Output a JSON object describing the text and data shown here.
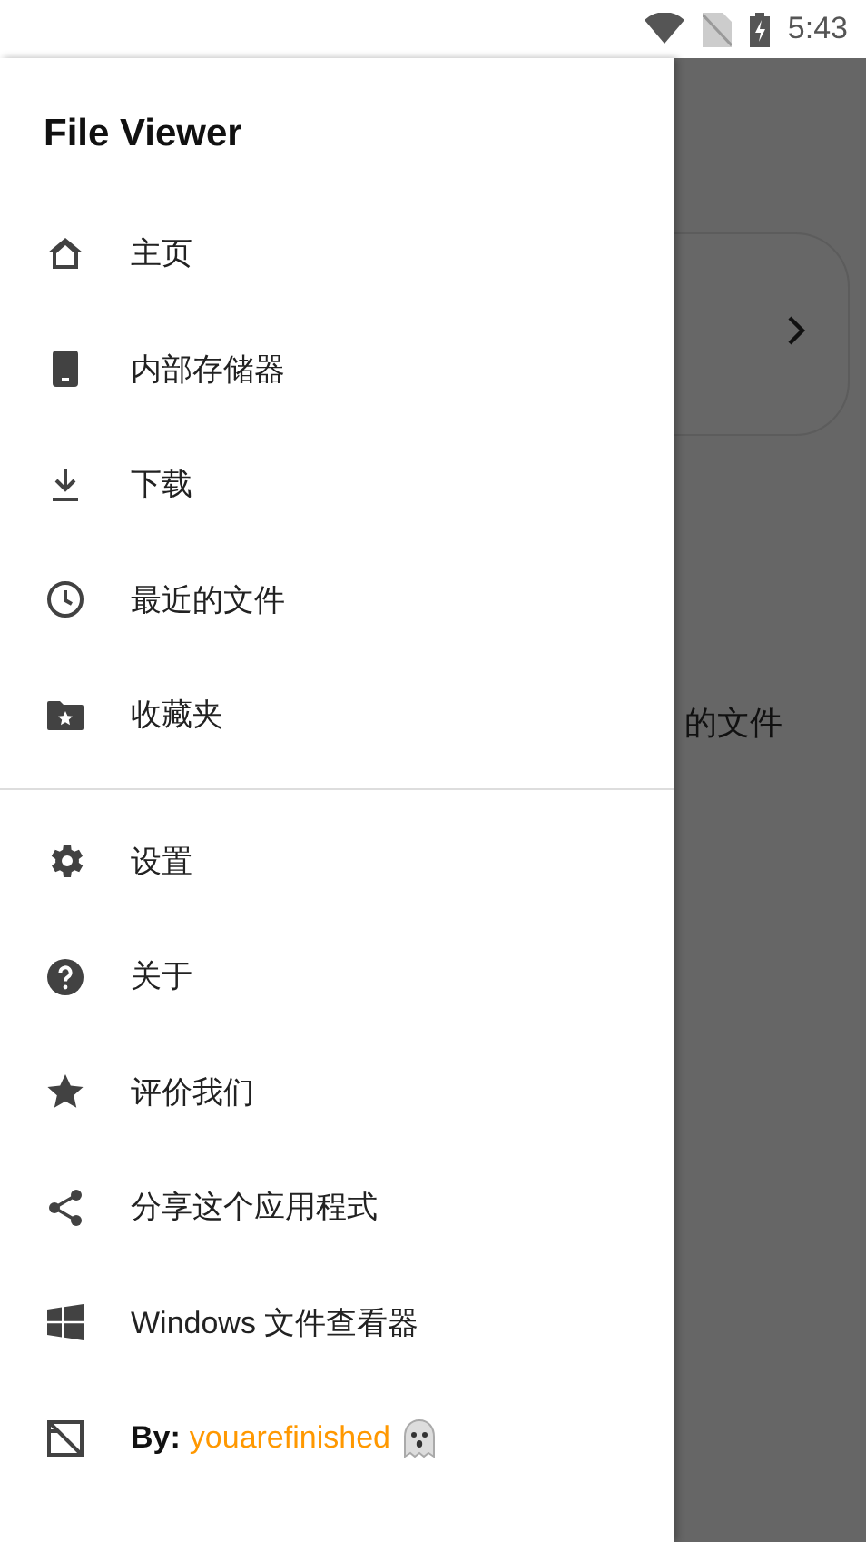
{
  "status_bar": {
    "time": "5:43"
  },
  "background": {
    "text": "的文件"
  },
  "drawer": {
    "title": "File Viewer",
    "sections": [
      [
        {
          "label": "主页"
        },
        {
          "label": "内部存储器"
        },
        {
          "label": "下载"
        },
        {
          "label": "最近的文件"
        },
        {
          "label": "收藏夹"
        }
      ],
      [
        {
          "label": "设置"
        },
        {
          "label": "关于"
        },
        {
          "label": "评价我们"
        },
        {
          "label": "分享这个应用程式"
        },
        {
          "label": "Windows 文件查看器"
        }
      ]
    ],
    "credit": {
      "label": "By:",
      "author": "youarefinished"
    }
  }
}
